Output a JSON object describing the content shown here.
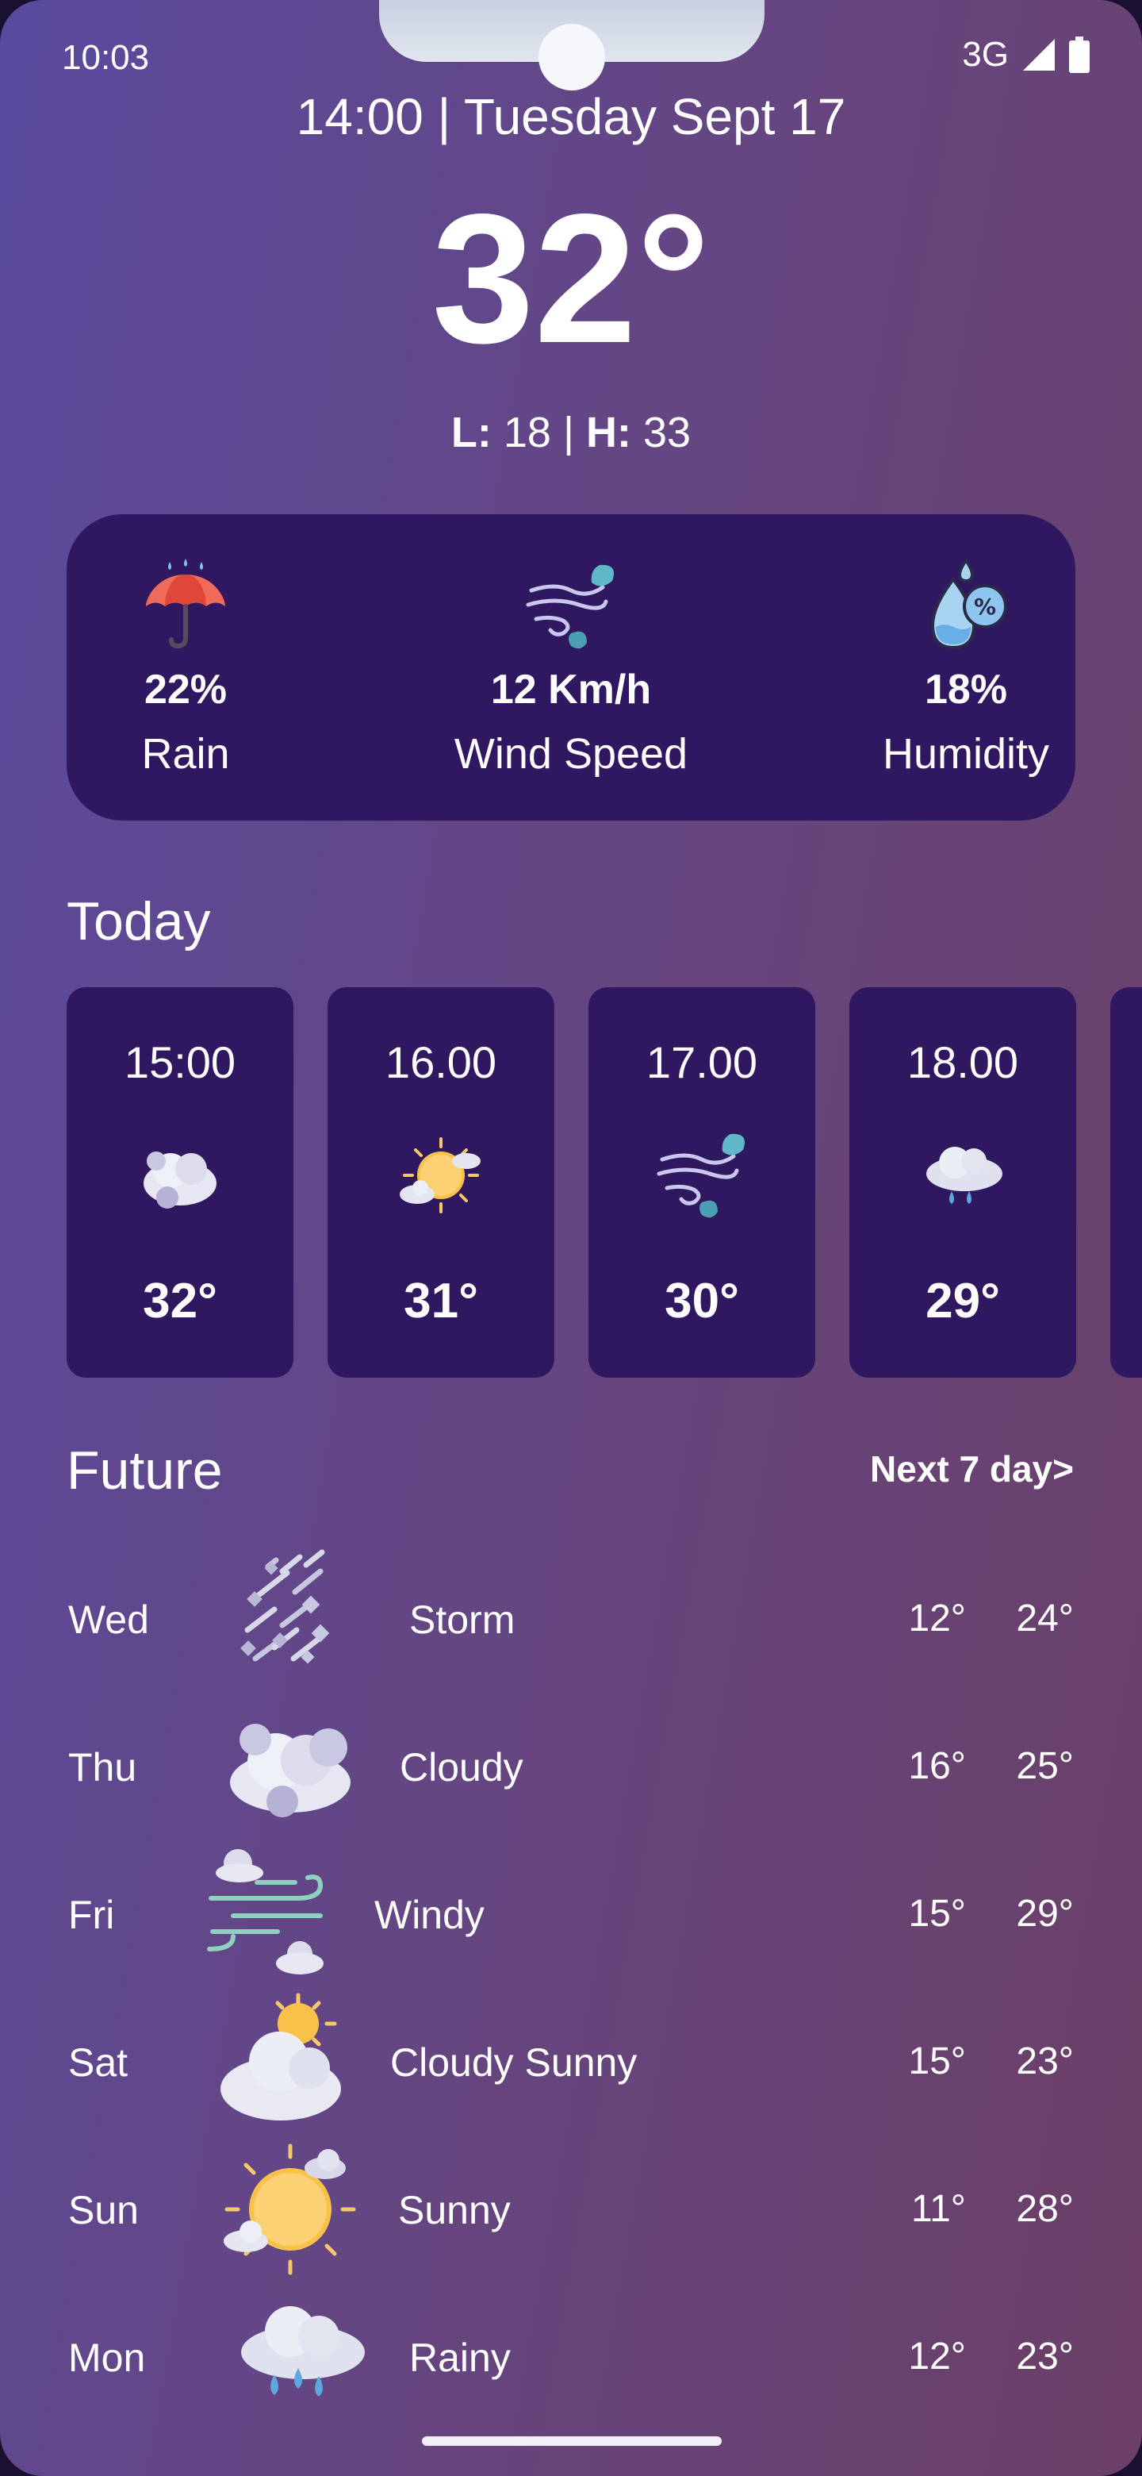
{
  "status_bar": {
    "time": "10:03",
    "network": "3G"
  },
  "header": {
    "datetime": "14:00 | Tuesday Sept 17",
    "temperature": "32°",
    "low_label": "L:",
    "low_value": "18",
    "separator": "|",
    "high_label": "H:",
    "high_value": "33"
  },
  "stats": [
    {
      "icon": "umbrella-icon",
      "value": "22%",
      "label": "Rain"
    },
    {
      "icon": "wind-icon",
      "value": "12 Km/h",
      "label": "Wind Speed"
    },
    {
      "icon": "humidity-icon",
      "value": "18%",
      "label": "Humidity"
    }
  ],
  "today": {
    "title": "Today",
    "hours": [
      {
        "time": "15:00",
        "icon": "cloudy-icon",
        "temp": "32°"
      },
      {
        "time": "16.00",
        "icon": "sunny-cloud-icon",
        "temp": "31°"
      },
      {
        "time": "17.00",
        "icon": "wind-icon",
        "temp": "30°"
      },
      {
        "time": "18.00",
        "icon": "rain-cloud-icon",
        "temp": "29°"
      }
    ]
  },
  "future": {
    "title": "Future",
    "next_link": "Next 7 day>",
    "days": [
      {
        "day": "Wed",
        "icon": "storm-icon",
        "condition": "Storm",
        "low": "12°",
        "high": "24°"
      },
      {
        "day": "Thu",
        "icon": "cloudy-icon",
        "condition": "Cloudy",
        "low": "16°",
        "high": "25°"
      },
      {
        "day": "Fri",
        "icon": "windy-icon",
        "condition": "Windy",
        "low": "15°",
        "high": "29°"
      },
      {
        "day": "Sat",
        "icon": "cloudy-sunny-icon",
        "condition": "Cloudy Sunny",
        "low": "15°",
        "high": "23°"
      },
      {
        "day": "Sun",
        "icon": "sunny-icon",
        "condition": "Sunny",
        "low": "11°",
        "high": "28°"
      },
      {
        "day": "Mon",
        "icon": "rainy-icon",
        "condition": "Rainy",
        "low": "12°",
        "high": "23°"
      }
    ]
  },
  "colors": {
    "card": "#2f1860",
    "gradient_start": "#5a4a9e",
    "gradient_end": "#6b3f66"
  }
}
